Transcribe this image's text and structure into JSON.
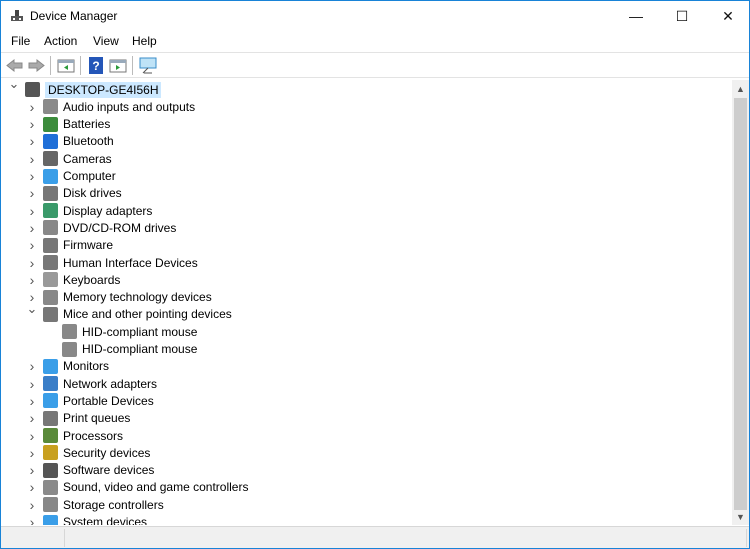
{
  "window": {
    "title": "Device Manager",
    "minimize": "—",
    "maximize": "☐",
    "close": "✕"
  },
  "menu": [
    "File",
    "Action",
    "View",
    "Help"
  ],
  "toolbar": [
    {
      "icon": "back-arrow-icon"
    },
    {
      "icon": "forward-arrow-icon"
    },
    {
      "icon": "show-hide-console-tree-icon"
    },
    {
      "icon": "help-icon"
    },
    {
      "icon": "properties-pane-icon"
    },
    {
      "icon": "scan-hardware-icon"
    }
  ],
  "tree": {
    "root": "DESKTOP-GE4I56H",
    "items": [
      {
        "label": "Audio inputs and outputs",
        "color": "#8a8a8a"
      },
      {
        "label": "Batteries",
        "color": "#3c8c3c"
      },
      {
        "label": "Bluetooth",
        "color": "#1f6fd8"
      },
      {
        "label": "Cameras",
        "color": "#666666"
      },
      {
        "label": "Computer",
        "color": "#3a9ee8"
      },
      {
        "label": "Disk drives",
        "color": "#777777"
      },
      {
        "label": "Display adapters",
        "color": "#3a9a6a"
      },
      {
        "label": "DVD/CD-ROM drives",
        "color": "#888888"
      },
      {
        "label": "Firmware",
        "color": "#777777"
      },
      {
        "label": "Human Interface Devices",
        "color": "#777777"
      },
      {
        "label": "Keyboards",
        "color": "#999999"
      },
      {
        "label": "Memory technology devices",
        "color": "#888888"
      },
      {
        "label": "Mice and other pointing devices",
        "color": "#777777",
        "expanded": true,
        "children": [
          "HID-compliant mouse",
          "HID-compliant mouse"
        ]
      },
      {
        "label": "Monitors",
        "color": "#3a9ee8"
      },
      {
        "label": "Network adapters",
        "color": "#3a7ec8"
      },
      {
        "label": "Portable Devices",
        "color": "#3a9ee8"
      },
      {
        "label": "Print queues",
        "color": "#777777"
      },
      {
        "label": "Processors",
        "color": "#5a8a3a"
      },
      {
        "label": "Security devices",
        "color": "#c8a020"
      },
      {
        "label": "Software devices",
        "color": "#555555"
      },
      {
        "label": "Sound, video and game controllers",
        "color": "#8a8a8a"
      },
      {
        "label": "Storage controllers",
        "color": "#888888"
      },
      {
        "label": "System devices",
        "color": "#3a9ee8"
      }
    ]
  }
}
